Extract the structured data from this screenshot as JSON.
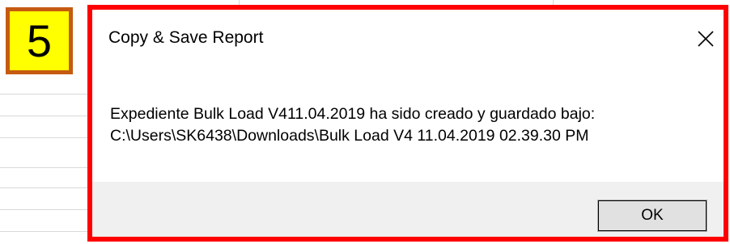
{
  "step_badge": {
    "number": "5"
  },
  "dialog": {
    "title": "Copy & Save Report",
    "close_icon": "close-icon",
    "message_line1": "Expediente Bulk Load V411.04.2019 ha sido creado y guardado bajo:",
    "message_line2": "C:\\Users\\SK6438\\Downloads\\Bulk Load V4 11.04.2019 02.39.30 PM",
    "ok_label": "OK"
  },
  "colors": {
    "highlight_border": "#ff0000",
    "badge_fill": "#ffff00",
    "badge_border": "#c55a11",
    "footer_bg": "#f0f0f0",
    "button_bg": "#e1e1e1"
  }
}
